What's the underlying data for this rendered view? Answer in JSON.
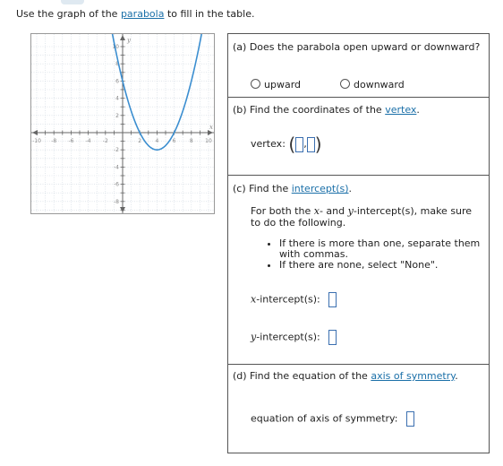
{
  "instruction": {
    "prefix": "Use the graph of the ",
    "link": "parabola",
    "suffix": " to fill in the table."
  },
  "graph": {
    "x_ticks": [
      "-10",
      "-8",
      "-6",
      "-4",
      "-2",
      "2",
      "4",
      "6",
      "8",
      "10"
    ],
    "y_ticks": [
      "10",
      "8",
      "6",
      "4",
      "2",
      "-2",
      "-4",
      "-6",
      "-8",
      "-10"
    ],
    "x_label": "x",
    "y_label": "y",
    "curve_color": "#3b8ed0",
    "parabola": {
      "vertex": [
        4,
        -2
      ],
      "a": 0.5,
      "xlim": [
        -10,
        10
      ],
      "ylim": [
        -10,
        10
      ]
    }
  },
  "a": {
    "question": "(a) Does the parabola open upward or downward?",
    "option_up": "upward",
    "option_down": "downward"
  },
  "b": {
    "q_prefix": "(b) Find the coordinates of the ",
    "q_link": "vertex",
    "q_suffix": ".",
    "label": "vertex:",
    "open": "(",
    "comma": ",",
    "close": ")"
  },
  "c": {
    "q_prefix": "(c) Find the ",
    "q_link": "intercept(s)",
    "q_suffix": ".",
    "p1": "For both the ",
    "p_x": "x",
    "p2": "- and ",
    "p_y": "y",
    "p3": "-intercept(s), make sure",
    "p4": "to do the following.",
    "bullet1_a": "If there is more than one, separate them",
    "bullet1_b": "with commas.",
    "bullet2": "If there are none, select \"None\".",
    "x_var": "x",
    "x_label": "-intercept(s):",
    "y_var": "y",
    "y_label": "-intercept(s):"
  },
  "d": {
    "q_prefix": "(d) Find the equation of the ",
    "q_link": "axis of symmetry",
    "q_suffix": ".",
    "label": "equation of axis of symmetry:"
  }
}
